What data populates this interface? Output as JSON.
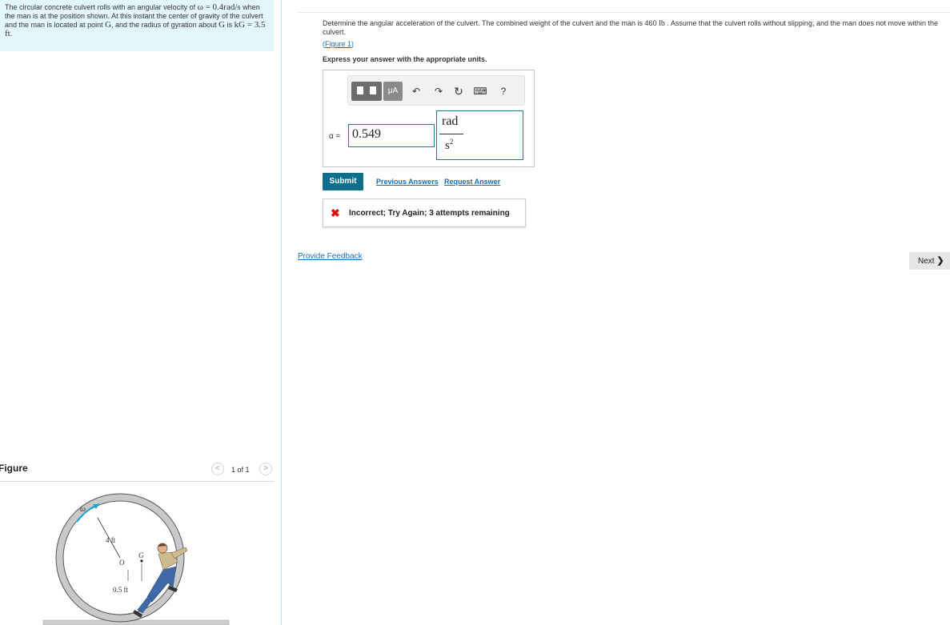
{
  "problem": {
    "text_a": "The circular concrete culvert rolls with an angular velocity of ",
    "omega_expr": "ω = 0.4rad/s",
    "text_b": " when the man is at the position shown. At this instant the center of gravity of the culvert and the man is located at point ",
    "point_g": "G",
    "text_c": ", and the radius of gyration about ",
    "g_again": "G",
    "text_d": " is ",
    "k_expr": "kG = 3.5 ft",
    "text_e": "."
  },
  "figure": {
    "title": "Figure",
    "count": "1 of 1",
    "labels": {
      "omega": "ω",
      "radius": "4 ft",
      "g": "G",
      "o": "O",
      "offset": "0.5 ft"
    }
  },
  "question": {
    "text": "Determine the angular acceleration of the culvert. The combined weight of the culvert and the man is 460 ",
    "unit": "lb",
    "text_b": " . Assume that the culvert rolls without slipping, and the man does not move within the culvert.",
    "figure_link": "Figure 1",
    "express": "Express your answer with the appropriate units."
  },
  "toolbar": {
    "units_label": "μA",
    "undo_icon": "↶",
    "redo_icon": "↷",
    "reset_icon": "↻",
    "keyboard_icon": "⌨",
    "help_label": "?"
  },
  "answer": {
    "variable_label": "α =",
    "value": "0.549",
    "unit_numerator": "rad",
    "unit_denominator": "s",
    "unit_exponent": "2"
  },
  "actions": {
    "submit": "Submit",
    "previous_answers": "Previous Answers",
    "request_answer": "Request Answer"
  },
  "feedback": {
    "icon": "✖",
    "text": "Incorrect; Try Again; 3 attempts remaining"
  },
  "footer": {
    "provide_feedback": "Provide Feedback",
    "next": "Next",
    "next_chevron": "❯"
  },
  "colors": {
    "problem_bg": "#e3f6f9",
    "accent": "#0f6e8c",
    "link": "#1a6fb0",
    "error": "#dd1111"
  }
}
